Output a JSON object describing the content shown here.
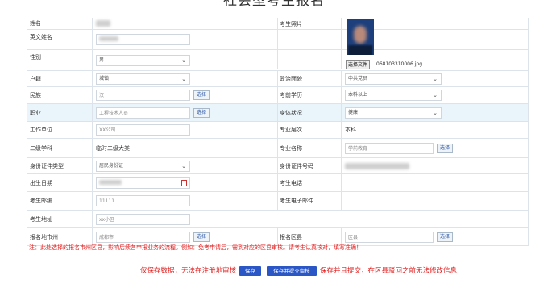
{
  "page": {
    "title": "社会型考生报名"
  },
  "form": {
    "name": {
      "label": "姓名"
    },
    "english_name": {
      "label": "英文姓名"
    },
    "gender": {
      "label": "性别",
      "value": "男"
    },
    "photo": {
      "label": "考生照片",
      "file_button": "选择文件",
      "file_name": "068103310006.jpg"
    },
    "hukou": {
      "label": "户籍",
      "value": "城镇"
    },
    "political": {
      "label": "政治面貌",
      "value": "中共党员"
    },
    "ethnicity": {
      "label": "民族",
      "value": "汉",
      "select_button": "选择"
    },
    "education": {
      "label": "考前学历",
      "value": "本科以上"
    },
    "occupation": {
      "label": "职业",
      "value": "工程技术人员",
      "select_button": "选择"
    },
    "health": {
      "label": "身体状况",
      "value": "健康"
    },
    "workplace": {
      "label": "工作单位",
      "value": "XX公司"
    },
    "level": {
      "label": "专业层次",
      "value": "本科"
    },
    "second_subject": {
      "label": "二级学科",
      "value": "临时二级大类"
    },
    "major": {
      "label": "专业名称",
      "value": "学前教育",
      "select_button": "选择"
    },
    "id_type": {
      "label": "身份证件类型",
      "value": "居民身份证"
    },
    "id_number": {
      "label": "身份证件号码"
    },
    "birthdate": {
      "label": "出生日期"
    },
    "phone": {
      "label": "考生电话"
    },
    "postcode": {
      "label": "考生邮编",
      "value": "11111"
    },
    "email": {
      "label": "考生电子邮件"
    },
    "address": {
      "label": "考生地址",
      "value": "xx小区"
    },
    "city": {
      "label": "报名地市州",
      "value": "成都市",
      "select_button": "选择"
    },
    "district": {
      "label": "报名区县",
      "value": "区县",
      "select_button": "选择"
    }
  },
  "notice": "注：此处选择的报名市州区县，影响后续各申报业务的流程。例如：免考申请后，需到对应的区县审核。请考生认真核对，填写准确！",
  "footer": {
    "save_note": "仅保存数据，无法在注册地审核",
    "save_button": "保存",
    "submit_button": "保存并提交审核",
    "submit_note": "保存并且提交，在区县驳回之前无法修改信息"
  },
  "colors": {
    "accent": "#2a56c6",
    "warning": "#e02020",
    "highlight_row": "#e9f4fb"
  }
}
